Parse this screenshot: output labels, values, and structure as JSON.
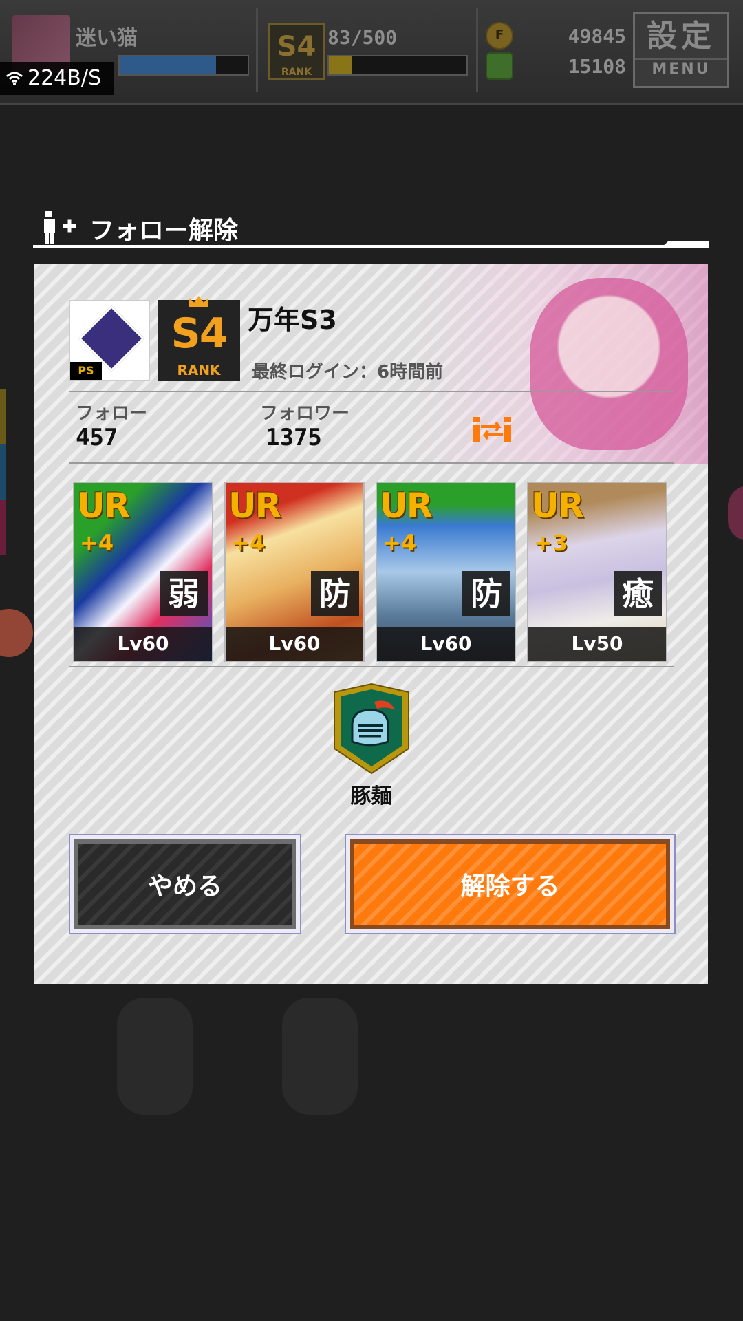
{
  "hud": {
    "player_name": "迷い猫",
    "exp_bar_fraction": 0.75,
    "rank_badge_number": "S4",
    "rank_badge_label": "RANK",
    "stamina": "83/500",
    "stamina_fraction": 0.166,
    "coin_icon_letter": "F",
    "coins": "49845",
    "gems": "15108",
    "menu_kanji": "設定",
    "menu_label": "MENU"
  },
  "status_overlay": {
    "net_speed": "224B/S"
  },
  "dialog": {
    "title": "フォロー解除",
    "player": {
      "name": "万年S3",
      "guild_tag": "PS",
      "rank_number": "S4",
      "rank_label": "RANK",
      "last_login": "最終ログイン：6時間前"
    },
    "stats": {
      "follow_label": "フォロー",
      "follow_value": "457",
      "follower_label": "フォロワー",
      "follower_value": "1375"
    },
    "cards": [
      {
        "rarity": "UR",
        "plus": "+4",
        "attribute": "弱",
        "level": "Lv60"
      },
      {
        "rarity": "UR",
        "plus": "+4",
        "attribute": "防",
        "level": "Lv60"
      },
      {
        "rarity": "UR",
        "plus": "+4",
        "attribute": "防",
        "level": "Lv60"
      },
      {
        "rarity": "UR",
        "plus": "+3",
        "attribute": "癒",
        "level": "Lv50"
      }
    ],
    "guild_name": "豚麺",
    "cancel_label": "やめる",
    "confirm_label": "解除する"
  },
  "colors": {
    "accent_orange": "#ff7a0c",
    "rank_gold": "#f2a11e",
    "panel_bg": "#dcdcdc",
    "overlay_dark": "#1f1f1f"
  },
  "icons": [
    "user-add-icon",
    "wifi-icon",
    "swap-icon",
    "knight-helmet-icon",
    "coin-icon",
    "gem-icon"
  ]
}
